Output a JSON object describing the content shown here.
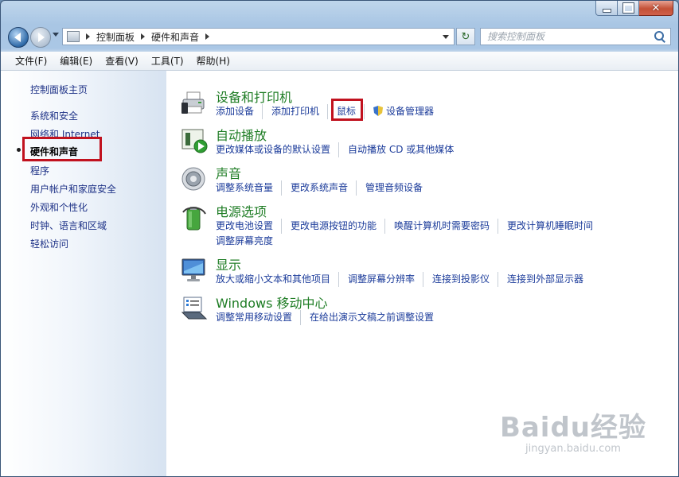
{
  "window": {
    "caption": {
      "close_glyph": "✕"
    }
  },
  "address": {
    "crumbs": [
      "控制面板",
      "硬件和声音"
    ],
    "search_placeholder": "搜索控制面板",
    "refresh_glyph": "↻"
  },
  "menubar": {
    "items": [
      "文件(F)",
      "编辑(E)",
      "查看(V)",
      "工具(T)",
      "帮助(H)"
    ]
  },
  "sidebar": {
    "items": [
      {
        "label": "控制面板主页"
      },
      {
        "label": "系统和安全"
      },
      {
        "label": "网络和 Internet"
      },
      {
        "label": "硬件和声音",
        "current": true
      },
      {
        "label": "程序"
      },
      {
        "label": "用户帐户和家庭安全"
      },
      {
        "label": "外观和个性化"
      },
      {
        "label": "时钟、语言和区域"
      },
      {
        "label": "轻松访问"
      }
    ]
  },
  "sections": [
    {
      "title": "设备和打印机",
      "icon": "printer-icon",
      "links": [
        "添加设备",
        "添加打印机",
        "鼠标",
        "设备管理器"
      ]
    },
    {
      "title": "自动播放",
      "icon": "autoplay-icon",
      "links": [
        "更改媒体或设备的默认设置",
        "自动播放 CD 或其他媒体"
      ]
    },
    {
      "title": "声音",
      "icon": "speaker-icon",
      "links": [
        "调整系统音量",
        "更改系统声音",
        "管理音频设备"
      ]
    },
    {
      "title": "电源选项",
      "icon": "battery-icon",
      "links": [
        "更改电池设置",
        "更改电源按钮的功能",
        "唤醒计算机时需要密码",
        "更改计算机睡眠时间",
        "调整屏幕亮度"
      ]
    },
    {
      "title": "显示",
      "icon": "monitor-icon",
      "links": [
        "放大或缩小文本和其他项目",
        "调整屏幕分辨率",
        "连接到投影仪",
        "连接到外部显示器"
      ]
    },
    {
      "title": "Windows 移动中心",
      "icon": "mobility-center-icon",
      "links": [
        "调整常用移动设置",
        "在给出演示文稿之前调整设置"
      ]
    }
  ],
  "watermark": {
    "logo": "Baidu经验",
    "url": "jingyan.baidu.com"
  },
  "colors": {
    "link": "#1b3b9a",
    "section_title": "#1f7d25",
    "highlight": "#c1121f"
  }
}
